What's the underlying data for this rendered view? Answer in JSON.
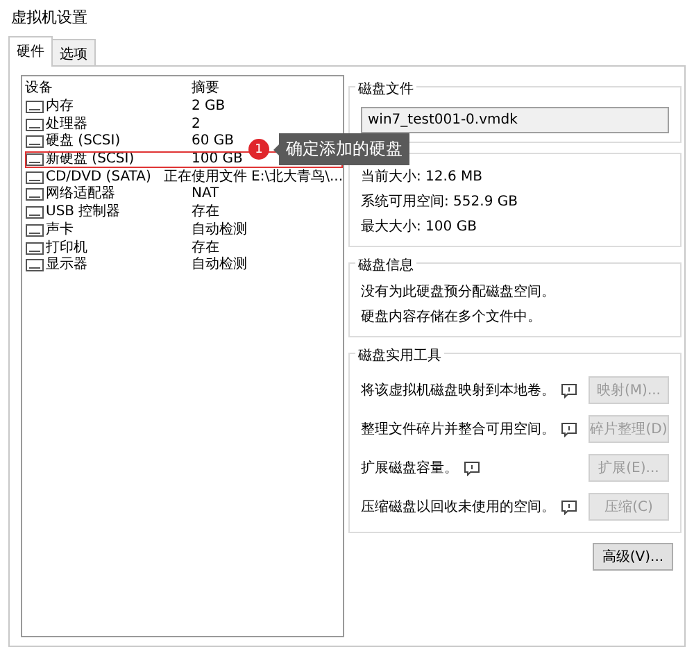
{
  "window": {
    "title": "虚拟机设置"
  },
  "tabs": [
    {
      "label": "硬件",
      "selected": true
    },
    {
      "label": "选项",
      "selected": false
    }
  ],
  "devices": {
    "columns": [
      "设备",
      "摘要"
    ],
    "rows": [
      {
        "name": "内存",
        "summary": "2 GB",
        "highlighted": false
      },
      {
        "name": "处理器",
        "summary": "2",
        "highlighted": false
      },
      {
        "name": "硬盘 (SCSI)",
        "summary": "60 GB",
        "highlighted": false
      },
      {
        "name": "新硬盘 (SCSI)",
        "summary": "100 GB",
        "highlighted": true
      },
      {
        "name": "CD/DVD (SATA)",
        "summary": "正在使用文件 E:\\北大青鸟\\...",
        "highlighted": false
      },
      {
        "name": "网络适配器",
        "summary": "NAT",
        "highlighted": false
      },
      {
        "name": "USB 控制器",
        "summary": "存在",
        "highlighted": false
      },
      {
        "name": "声卡",
        "summary": "自动检测",
        "highlighted": false
      },
      {
        "name": "打印机",
        "summary": "存在",
        "highlighted": false
      },
      {
        "name": "显示器",
        "summary": "自动检测",
        "highlighted": false
      }
    ]
  },
  "callout": {
    "number": "1",
    "text": "确定添加的硬盘"
  },
  "disk_file": {
    "title": "磁盘文件",
    "value": "win7_test001-0.vmdk"
  },
  "capacity": {
    "lines": [
      "当前大小: 12.6 MB",
      "系统可用空间: 552.9 GB",
      "最大大小: 100 GB"
    ]
  },
  "disk_info": {
    "title": "磁盘信息",
    "lines": [
      "没有为此硬盘预分配磁盘空间。",
      "硬盘内容存储在多个文件中。"
    ]
  },
  "utilities": {
    "title": "磁盘实用工具",
    "rows": [
      {
        "text": "将该虚拟机磁盘映射到本地卷。",
        "button": "映射(M)...",
        "disabled": true
      },
      {
        "text": "整理文件碎片并整合可用空间。",
        "button": "碎片整理(D)",
        "disabled": true
      },
      {
        "text": "扩展磁盘容量。",
        "button": "扩展(E)...",
        "disabled": true
      },
      {
        "text": "压缩磁盘以回收未使用的空间。",
        "button": "压缩(C)",
        "disabled": true
      }
    ]
  },
  "advanced_button": "高级(V)..."
}
